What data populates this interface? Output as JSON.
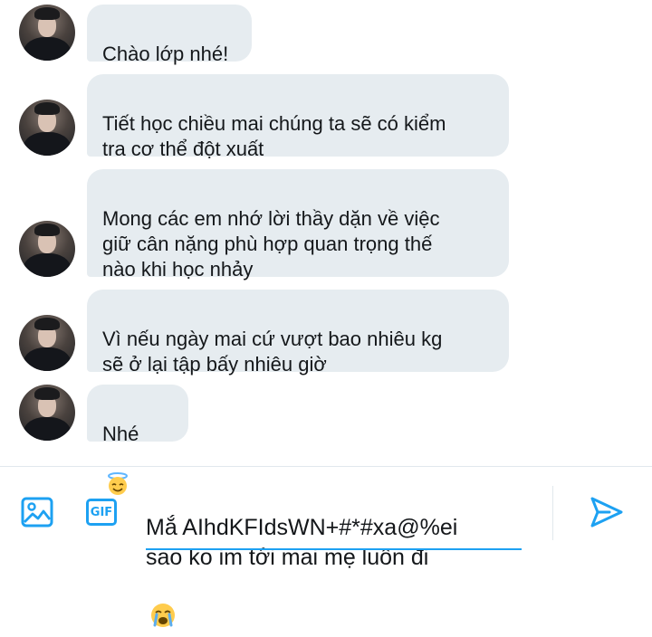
{
  "conversation": {
    "messages": [
      {
        "text": "Chào lớp nhé!",
        "emoji": ""
      },
      {
        "text": "Tiết học chiều mai chúng ta sẽ có kiểm\ntra cơ thể đột xuất",
        "emoji": ""
      },
      {
        "text": "Mong các em nhớ lời thầy dặn về việc\ngiữ cân nặng phù hợp quan trọng thế\nnào khi học nhảy",
        "emoji": ""
      },
      {
        "text": "Vì nếu ngày mai cứ vượt bao nhiêu kg\nsẽ ở lại tập bấy nhiêu giờ",
        "emoji": ""
      },
      {
        "text": "Nhé",
        "emoji": "smiling-face-with-halo"
      }
    ]
  },
  "composer": {
    "gif_label": "GIF",
    "draft_text": "Mắ AIhdKFIdsWN+#*#xa@%ei\nsao ko im tới mai mẹ luôn đi",
    "draft_emoji": "loudly-crying-face",
    "icons": [
      "image-icon",
      "gif-icon",
      "send-icon"
    ]
  },
  "colors": {
    "accent": "#1da1f2",
    "bubble_bg": "#e6ecf0",
    "text": "#14171a"
  }
}
